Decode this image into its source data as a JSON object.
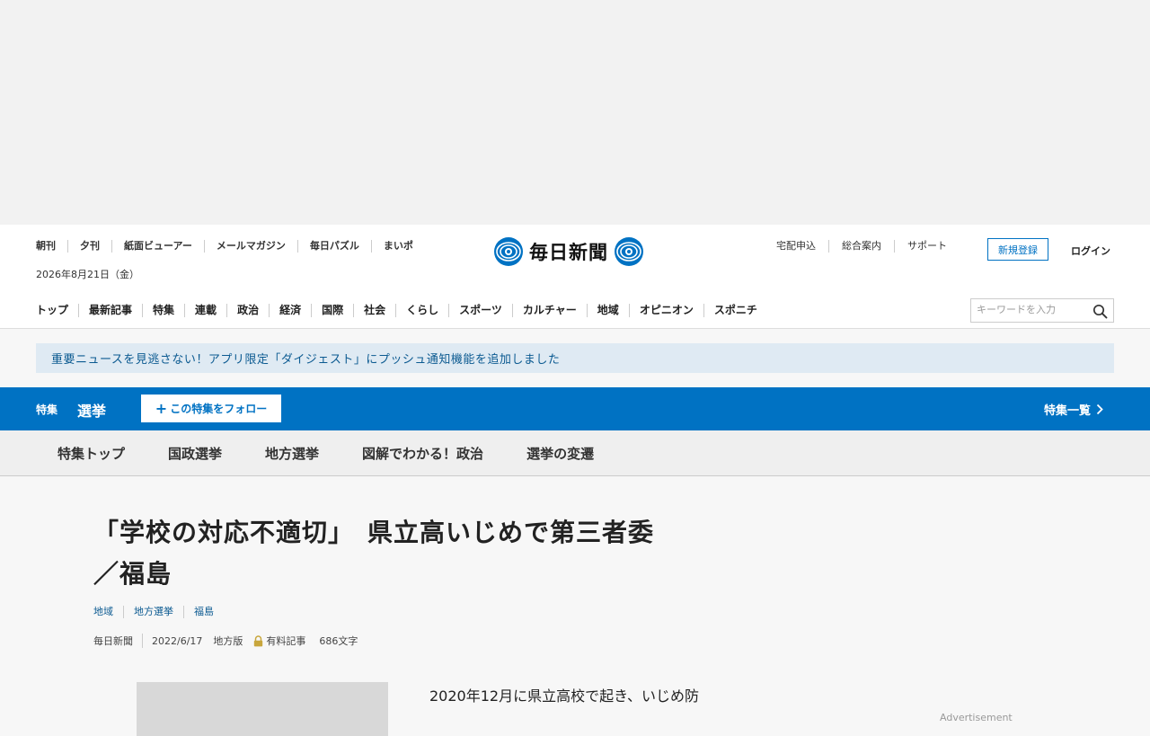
{
  "header": {
    "util_left": [
      "朝刊",
      "夕刊",
      "紙面ビューアー",
      "メールマガジン",
      "毎日パズル",
      "まいポ"
    ],
    "date": "2026年8月21日（金）",
    "logo_text": "毎日新聞",
    "util_right": [
      "宅配申込",
      "総合案内",
      "サポート"
    ],
    "register_label": "新規登録",
    "login_label": "ログイン",
    "gnav": [
      "トップ",
      "最新記事",
      "特集",
      "連載",
      "政治",
      "経済",
      "国際",
      "社会",
      "くらし",
      "スポーツ",
      "カルチャー",
      "地域",
      "オピニオン",
      "スポニチ"
    ],
    "search_placeholder": "キーワードを入力"
  },
  "notice": "重要ニュースを見逃さない！アプリ限定「ダイジェスト」にプッシュ通知機能を追加しました",
  "feature": {
    "label": "特集",
    "title": "選挙",
    "follow_label": "この特集をフォロー",
    "list_label": "特集一覧"
  },
  "subnav": [
    "特集トップ",
    "国政選挙",
    "地方選挙",
    "図解でわかる！政治",
    "選挙の変遷"
  ],
  "article": {
    "headline_line1": "「学校の対応不適切」　県立高いじめで第三者委",
    "headline_line2": "／福島",
    "tags": [
      "地域",
      "地方選挙",
      "福島"
    ],
    "source": "毎日新聞",
    "date": "2022/6/17",
    "edition": "地方版",
    "paid_label": "有料記事",
    "char_count": "686文字",
    "body": "　2020年12月に県立高校で起き、いじめ防"
  },
  "ad_label": "Advertisement",
  "colors": {
    "accent": "#0072c3",
    "notice_bg": "#dfeaf3",
    "link": "#0b5a91"
  }
}
